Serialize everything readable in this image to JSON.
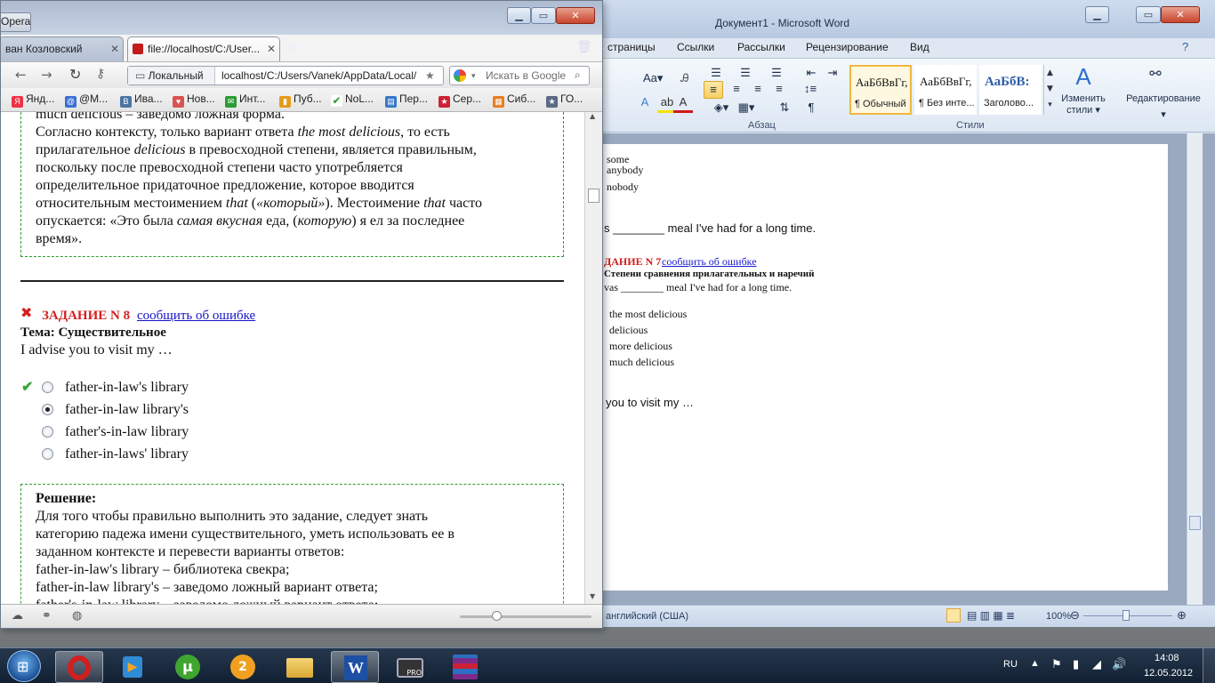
{
  "word": {
    "title": "Документ1  -  Microsoft Word",
    "tabs": [
      "страницы",
      "Ссылки",
      "Рассылки",
      "Рецензирование",
      "Вид"
    ],
    "groups": {
      "paragraph": "Абзац",
      "styles": "Стили"
    },
    "styles": [
      {
        "sample": "АаБбВвГг,",
        "name": "¶ Обычный"
      },
      {
        "sample": "АаБбВвГг,",
        "name": "¶ Без инте..."
      },
      {
        "sample": "АаБбВ:",
        "name": "Заголово..."
      }
    ],
    "change_styles": [
      "Изменить",
      "стили"
    ],
    "editing": "Редактирование",
    "doc": {
      "lines": [
        "some",
        "anybody",
        "nobody"
      ],
      "sentence1": "s ________ meal I've had for a long time.",
      "task_label": "ДАНИЕ N 7",
      "task_link": "сообщить об ошибке",
      "topic": "Степени сравнения прилагательных и наречий",
      "question": "vas ________ meal I've had for a long time.",
      "options": [
        "the most delicious",
        "delicious",
        "more delicious",
        "much delicious"
      ],
      "sentence2": "you to visit my …"
    },
    "status": {
      "language": "английский (США)",
      "zoom": "100%"
    }
  },
  "opera": {
    "menu": "Opera",
    "tabs": [
      {
        "label": "ван Козловский"
      },
      {
        "label": "file://localhost/C:/User..."
      }
    ],
    "address_label": "Локальный",
    "address": "localhost/C:/Users/Vanek/AppData/Local/",
    "search_placeholder": "Искать в Google",
    "bookmarks": [
      "Янд...",
      "@M...",
      "Ива...",
      "Нов...",
      "Инт...",
      "Пуб...",
      "NoL...",
      "Пер...",
      "Сер...",
      "Сиб...",
      "ГО..."
    ],
    "content": {
      "prev_lines": [
        "much delicious – заведомо ложная форма.",
        "Согласно контексту, только вариант ответа the most delicious, то есть",
        "прилагательное delicious в превосходной степени, является правильным,",
        "поскольку после превосходной степени часто употребляется",
        "определительное придаточное предложение, которое вводится",
        "относительным местоимением that («который»). Местоимение that часто",
        "опускается: «Это была самая вкусная еда, (которую) я ел за последнее",
        "время»."
      ],
      "task_label": "ЗАДАНИЕ N 8",
      "task_link": "сообщить об ошибке",
      "topic": "Тема: Существительное",
      "question": "I advise you to visit my …",
      "options": [
        "father-in-law's library",
        "father-in-law library's",
        "father's-in-law library",
        "father-in-laws' library"
      ],
      "selected_option": 2,
      "correct_option": 1,
      "solution_title": "Решение:",
      "solution_lines": [
        "Для того чтобы правильно выполнить это задание, следует знать",
        "категорию падежа имени существительного, уметь использовать ее в",
        "заданном контексте и перевести варианты ответов:",
        "father-in-law's library – библиотека свекра;",
        "father-in-law library's – заведомо ложный вариант ответа;",
        "father's-in-law library – заведомо ложный вариант ответа;"
      ]
    }
  },
  "taskbar": {
    "language": "RU",
    "time": "14:08",
    "date": "12.05.2012"
  }
}
